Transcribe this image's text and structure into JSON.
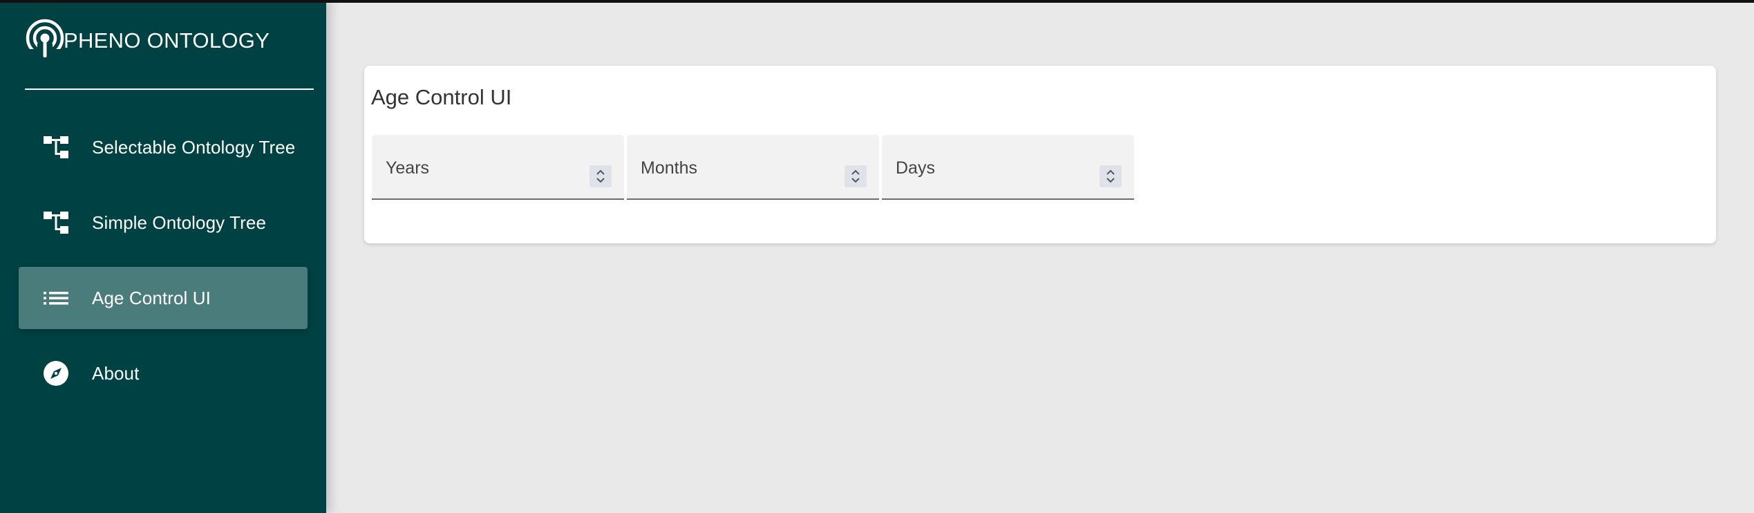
{
  "app": {
    "title": "PHENO ONTOLOGY",
    "logo_icon": "podcast-broadcast-icon"
  },
  "sidebar": {
    "items": [
      {
        "label": "Selectable Ontology Tree",
        "icon": "tree-structure-icon",
        "active": false
      },
      {
        "label": "Simple Ontology Tree",
        "icon": "tree-structure-icon",
        "active": false
      },
      {
        "label": "Age Control UI",
        "icon": "list-icon",
        "active": true
      },
      {
        "label": "About",
        "icon": "compass-icon",
        "active": false
      }
    ]
  },
  "card": {
    "title": "Age Control UI",
    "fields": [
      {
        "label": "Years",
        "value": ""
      },
      {
        "label": "Months",
        "value": ""
      },
      {
        "label": "Days",
        "value": ""
      }
    ]
  },
  "colors": {
    "sidebar_bg": "#004143",
    "active_item_bg": "#4a7c7b",
    "page_bg": "#e9e9e9",
    "card_bg": "#ffffff"
  }
}
